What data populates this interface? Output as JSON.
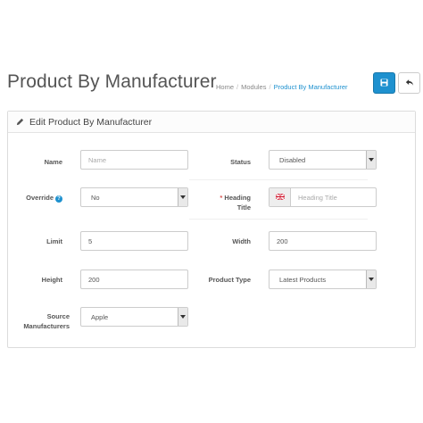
{
  "header": {
    "title": "Product By Manufacturer",
    "breadcrumb": [
      "Home",
      "Modules",
      "Product By Manufacturer"
    ]
  },
  "panel": {
    "title": "Edit Product By Manufacturer"
  },
  "form": {
    "name": {
      "label": "Name",
      "placeholder": "Name",
      "value": ""
    },
    "status": {
      "label": "Status",
      "value": "Disabled"
    },
    "override": {
      "label": "Override",
      "value": "No"
    },
    "heading_title": {
      "label_line1": "Heading",
      "label_line2": "Title",
      "required_mark": "*",
      "placeholder": "Heading Title"
    },
    "limit": {
      "label": "Limit",
      "value": "5"
    },
    "width": {
      "label": "Width",
      "value": "200"
    },
    "height": {
      "label": "Height",
      "value": "200"
    },
    "product_type": {
      "label": "Product Type",
      "value": "Latest Products"
    },
    "source": {
      "label_line1": "Source",
      "label_line2": "Manufacturers",
      "value": "Apple"
    }
  },
  "colors": {
    "primary": "#1e91cf",
    "required": "#d9534f"
  },
  "icons": {
    "save": "save-icon",
    "back": "reply-icon",
    "pencil": "pencil-icon",
    "help": "question-circle-icon",
    "flag": "flag-icon"
  }
}
